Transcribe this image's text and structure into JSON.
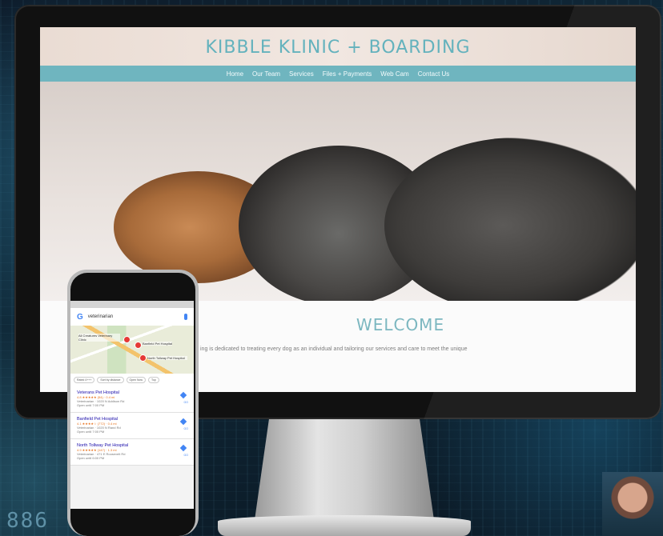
{
  "site": {
    "title": "KIBBLE KLINIC + BOARDING",
    "nav": [
      "Home",
      "Our Team",
      "Services",
      "Files + Payments",
      "Web Cam",
      "Contact Us"
    ],
    "welcome_title": "WELCOME",
    "welcome_text": "ing is dedicated to treating every dog as an individual and tailoring our services and care to meet the unique"
  },
  "phone": {
    "search_query": "veterinarian",
    "map_pins": [
      "All Creatures Veterinary Clinic",
      "Banfield Pet Hospital",
      "North Tollway Pet Hospital"
    ],
    "chips": [
      "Rated 4+++",
      "Sort by distance",
      "Open Now",
      "Top"
    ],
    "results": [
      {
        "name": "Veterans Pet Hospital",
        "rating": "4.8 ★★★★★ (54) · 0.4 mi",
        "line1": "Veterinarian · 1020 N Addison Rd",
        "line2": "Open until 7:00 PM",
        "dir": "GO"
      },
      {
        "name": "Banfield Pet Hospital",
        "rating": "4.1 ★★★★☆ (772) · 0.4 mi",
        "line1": "Veterinarian · 1020 N Rand Rd",
        "line2": "Open until 7:00 PM",
        "dir": "GO"
      },
      {
        "name": "North Tollway Pet Hospital",
        "rating": "4.9 ★★★★★ (147) · 1.3 mi",
        "line1": "Veterinarian · 471 E Roosevelt Rd",
        "line2": "Open until 6:00 PM",
        "dir": "GO"
      }
    ]
  },
  "background": {
    "digits": "886"
  },
  "colors": {
    "accent": "#6fb5bf",
    "title": "#64b2bd",
    "header_bg": "#eadcd3"
  }
}
